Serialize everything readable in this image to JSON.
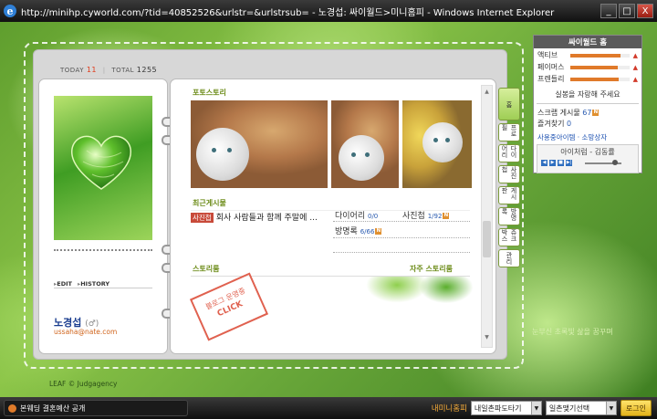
{
  "window": {
    "title": "http://minihp.cyworld.com/?tid=40852526&urlstr=&urlstrsub= - 노경섭: 싸이월드>미니홈피 - Windows Internet Explorer",
    "buttons": [
      "_",
      "□",
      "X"
    ]
  },
  "counter": {
    "today_label": "TODAY",
    "today_value": "11",
    "separator": "|",
    "total_label": "TOTAL",
    "total_value": "1255"
  },
  "profile": {
    "edit": "EDIT",
    "history": "HISTORY",
    "name": "노경섭",
    "gender": "(♂)",
    "email": "ussaha@nate.com"
  },
  "main": {
    "photo_story_label": "포토스토리",
    "recent_posts_label": "최근게시물",
    "recent_post": {
      "badge": "사진첩",
      "text": "회사 사람들과 함께 주말에 ..."
    },
    "stats": [
      {
        "label": "다이어리",
        "value": "0/0"
      },
      {
        "label": "사진첩",
        "value": "1/92"
      },
      {
        "label": "방명록",
        "value": "6/66"
      }
    ],
    "new_icon": "N",
    "story_room_label": "스토리룸",
    "frequent_story_label": "자주 스토리룸",
    "stamp_line1": "블로그 운영중",
    "stamp_line2": "CLICK"
  },
  "side_tabs": [
    "홈",
    "프로필",
    "다이어리",
    "사진첩",
    "게시판",
    "방명록",
    "쥬크박스",
    "관리"
  ],
  "widget": {
    "header": "싸이월드 홈",
    "bars": [
      {
        "label": "액티브",
        "fraction": 0.85
      },
      {
        "label": "페이머스",
        "fraction": 0.8
      },
      {
        "label": "프렌들리",
        "fraction": 0.82
      }
    ],
    "bar_icon": "▲",
    "praise": "실봉을 자랑해 주세요",
    "scrap_label": "스크랩 게시물",
    "scrap_value": "67",
    "favorites_label": "즐겨찾기",
    "favorites_value": "0",
    "links": "사용중아이템 · 소망상자",
    "bgm_title": "아이처럼 - 김동률",
    "bgm_controls": [
      "◀",
      "▶",
      "■",
      "▶|"
    ]
  },
  "hint_text": "눈부신 초록빛 삶을 꿈꾸며",
  "credit": "LEAF © Judgagency",
  "bottombar": {
    "ticker": "본웨딩 결혼예산 공개",
    "minihome_link": "내미니홈피",
    "select1": "내일촌파도타기",
    "select2": "일촌맺기선택",
    "logout": "로그인"
  }
}
